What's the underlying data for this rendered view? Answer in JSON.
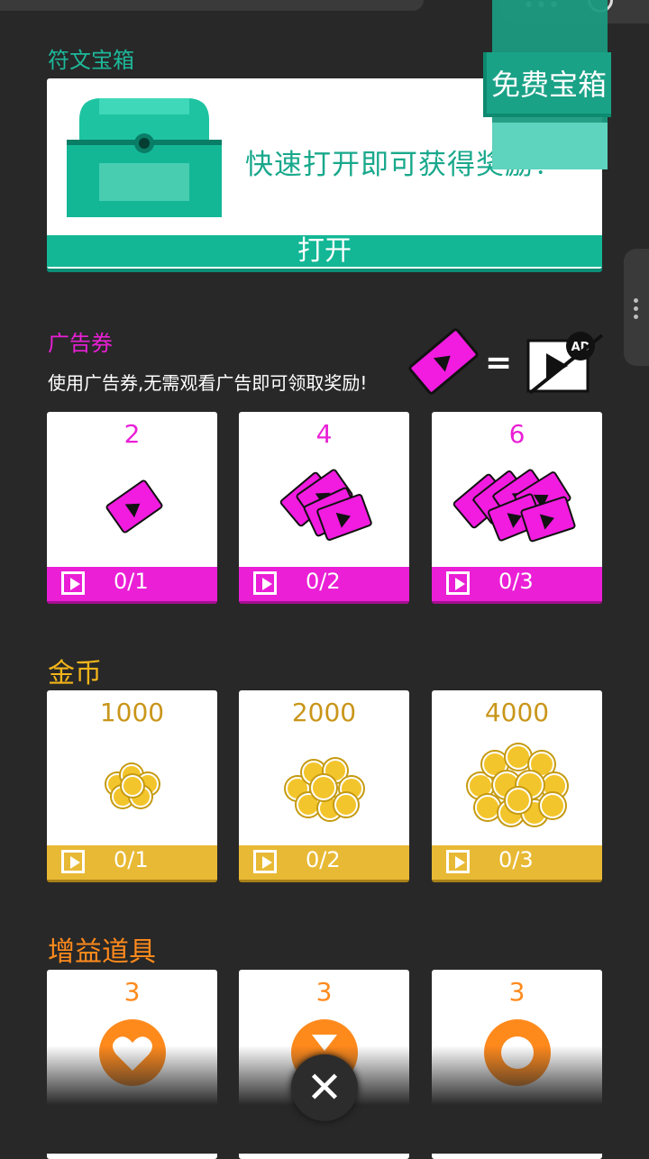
{
  "chest": {
    "title": "符文宝箱",
    "message": "快速打开即可获得奖励！",
    "open_label": "打开",
    "free_label": "免费宝箱"
  },
  "ad_tickets": {
    "title": "广告券",
    "description": "使用广告券,无需观看广告即可领取奖励!",
    "equals": "=",
    "cards": [
      {
        "value": "2",
        "progress": "0/1"
      },
      {
        "value": "4",
        "progress": "0/2"
      },
      {
        "value": "6",
        "progress": "0/3"
      }
    ]
  },
  "coins": {
    "title": "金币",
    "cards": [
      {
        "value": "1000",
        "progress": "0/1"
      },
      {
        "value": "2000",
        "progress": "0/2"
      },
      {
        "value": "4000",
        "progress": "0/3"
      }
    ]
  },
  "boosts": {
    "title": "增益道具",
    "cards": [
      {
        "value": "3",
        "icon": "heart-icon"
      },
      {
        "value": "3",
        "icon": "hourglass-icon"
      },
      {
        "value": "3",
        "icon": "ring-icon"
      }
    ]
  },
  "close_label": "✕",
  "colors": {
    "teal": "#13b796",
    "magenta": "#ea1fd6",
    "gold": "#e8b935",
    "orange": "#ff8a1c"
  }
}
